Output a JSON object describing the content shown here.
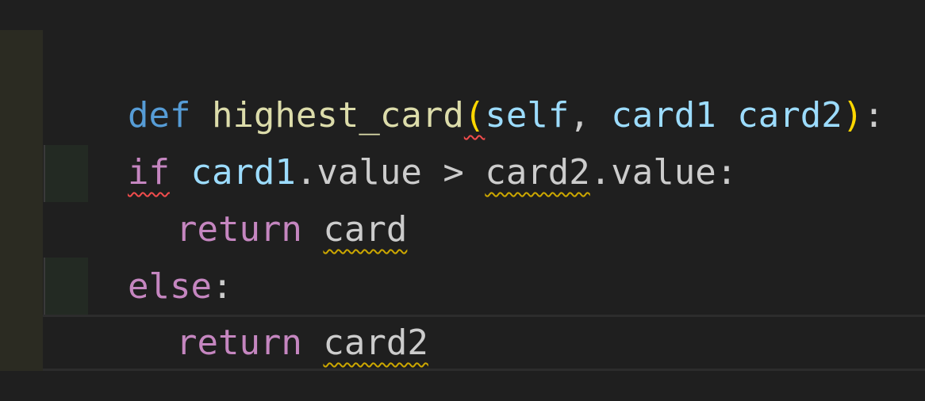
{
  "editor": {
    "lines": [
      {
        "tokens": [
          "def",
          " ",
          "highest_card",
          "(",
          "self",
          ", ",
          "card1",
          " ",
          "card2",
          ")",
          ":"
        ]
      },
      {
        "tokens": [
          "if",
          " ",
          "card1",
          ".value > ",
          "card2",
          ".value:"
        ]
      },
      {
        "tokens": [
          "return",
          " ",
          "card"
        ]
      },
      {
        "tokens": [
          "else",
          ":"
        ]
      },
      {
        "tokens": [
          "return",
          " ",
          "card2"
        ]
      }
    ]
  },
  "colors": {
    "background": "#1f1f1f",
    "keyword_def": "#569cd6",
    "keyword_control": "#c586c0",
    "function_name": "#dcdcaa",
    "parameter": "#9cdcfe",
    "bracket": "#ffd700",
    "error_squiggle": "#f14c4c",
    "warning_squiggle": "#cca700"
  }
}
